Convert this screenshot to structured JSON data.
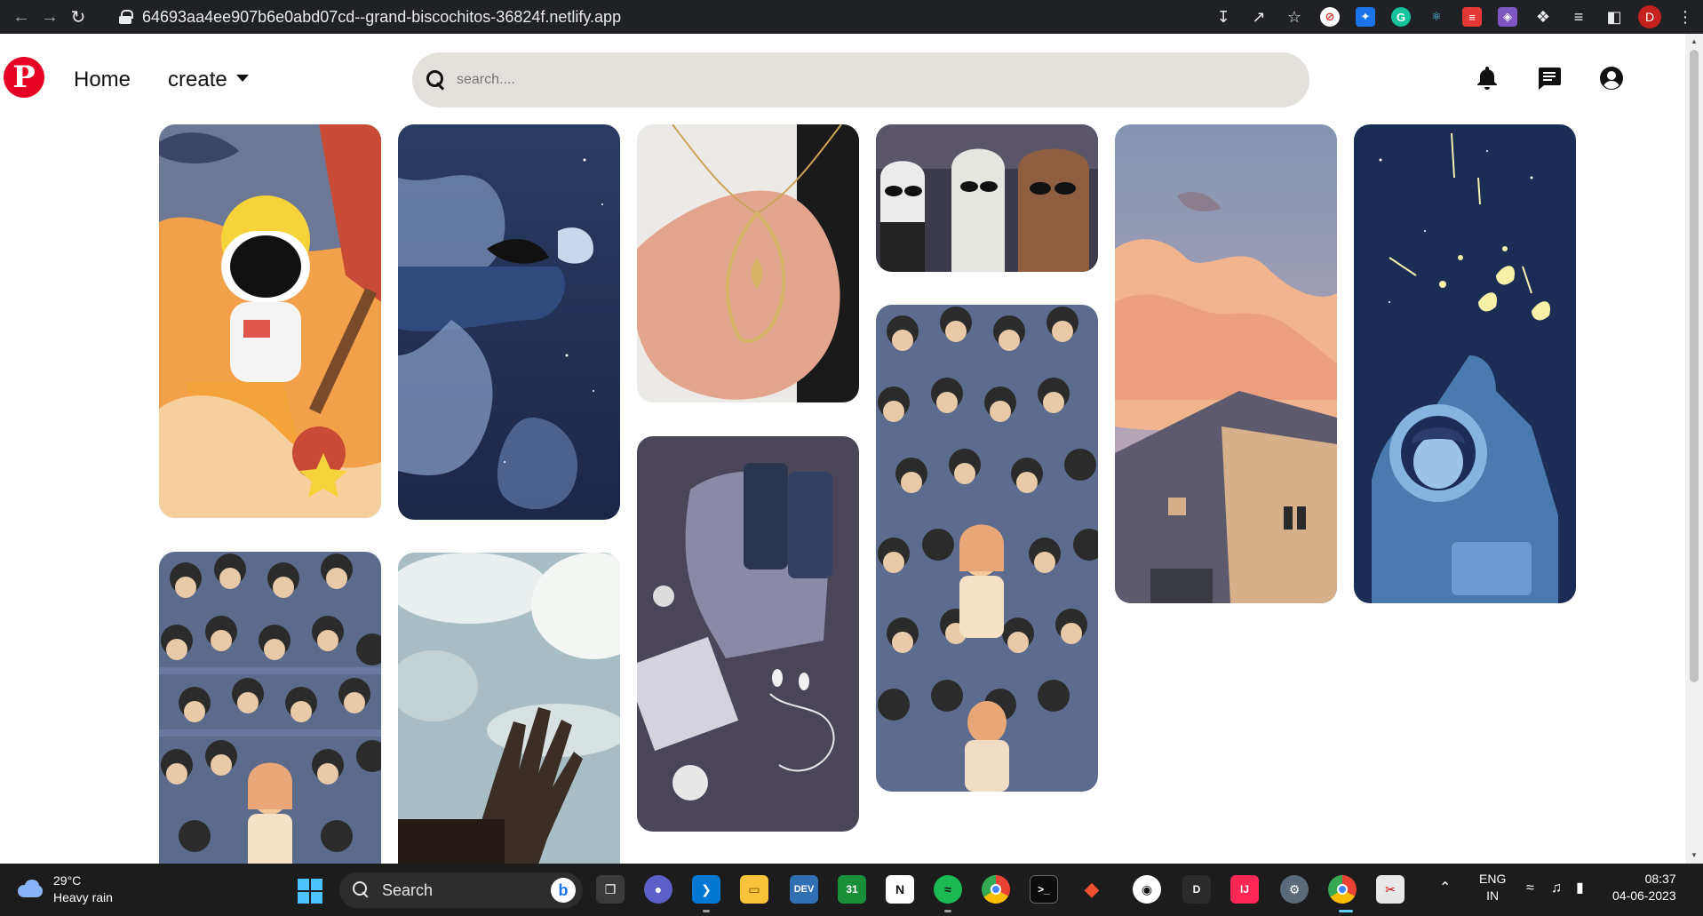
{
  "browser": {
    "url": "64693aa4ee907b6e0abd07cd--grand-biscochitos-36824f.netlify.app",
    "profile_initial": "D"
  },
  "header": {
    "logo_letter": "P",
    "home_label": "Home",
    "create_label": "create",
    "search_placeholder": "search....",
    "accent_color": "#e60023"
  },
  "pins": [
    {
      "name": "astronaut-construction",
      "desc": "illustration"
    },
    {
      "name": "anime-night-sky",
      "desc": "illustration"
    },
    {
      "name": "feather-necklace",
      "desc": "photo"
    },
    {
      "name": "bears-sunglasses",
      "desc": "illustration"
    },
    {
      "name": "sunset-house",
      "desc": "illustration"
    },
    {
      "name": "astronaut-butterflies",
      "desc": "illustration"
    },
    {
      "name": "crowd-girl",
      "desc": "illustration"
    },
    {
      "name": "hand-sky",
      "desc": "photo"
    },
    {
      "name": "cans-earphones",
      "desc": "illustration"
    },
    {
      "name": "crowd-girl-2",
      "desc": "illustration"
    }
  ],
  "taskbar": {
    "weather_temp": "29°C",
    "weather_desc": "Heavy rain",
    "search_label": "Search",
    "lang_top": "ENG",
    "lang_bottom": "IN",
    "time": "08:37",
    "date": "04-06-2023",
    "apps": [
      "task-view",
      "teams",
      "vscode",
      "file-explorer",
      "devtoys",
      "calendar",
      "notion",
      "spotify",
      "chrome",
      "terminal",
      "git",
      "github",
      "dev-d",
      "intellij",
      "settings",
      "chrome-profile",
      "snipping"
    ]
  }
}
